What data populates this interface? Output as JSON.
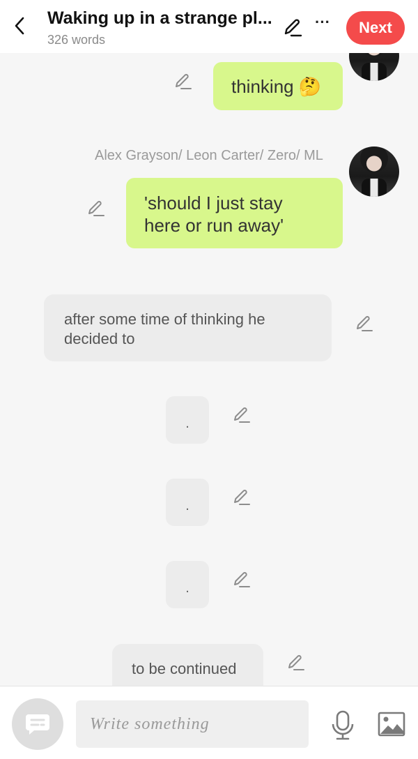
{
  "header": {
    "back_icon": "chevron-left-icon",
    "title": "Waking up in a strange pl...",
    "word_count": "326 words",
    "edit_icon": "pencil-icon",
    "more_label": "···",
    "next_label": "Next",
    "next_color": "#f44b4b"
  },
  "messages": [
    {
      "type": "right",
      "text": "thinking 🤔"
    },
    {
      "type": "right-named",
      "name": "Alex Grayson/ Leon Carter/ Zero/ ML",
      "line1": "'should I just stay",
      "line2": "here or run away'"
    },
    {
      "type": "narration",
      "line1": "after some time of thinking he",
      "line2": "decided to"
    },
    {
      "type": "narration",
      "text": "."
    },
    {
      "type": "narration",
      "text": "."
    },
    {
      "type": "narration",
      "text": "."
    },
    {
      "type": "narration",
      "text": "to be continued"
    }
  ],
  "composer": {
    "placeholder": "Write something",
    "chat_icon": "chat-bubble-icon",
    "mic_icon": "microphone-icon",
    "image_icon": "image-icon"
  },
  "colors": {
    "green_bubble": "#d8f78c",
    "gray_bubble": "#ececec",
    "background": "#f6f6f6"
  }
}
